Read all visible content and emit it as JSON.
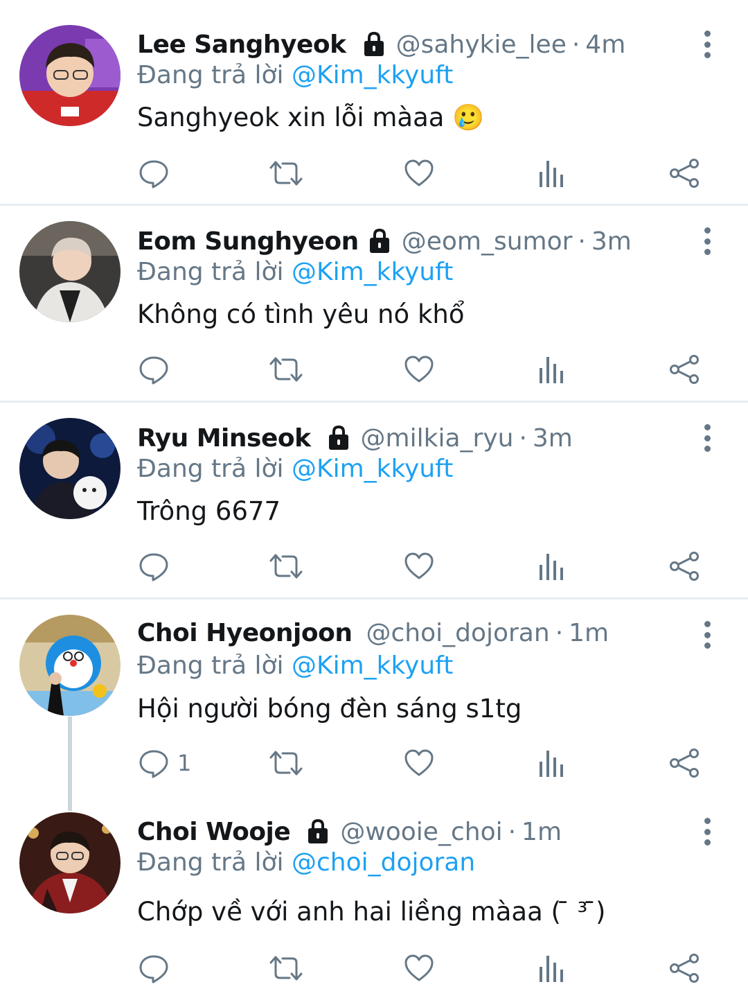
{
  "tweets": [
    {
      "name": "Lee Sanghyeok",
      "handle": "@sahykie_lee",
      "separator": "·",
      "time": "4m",
      "protected": true,
      "replying_prefix": "Đang trả lời ",
      "replying_to": "@Kim_kkyuft",
      "text": "Sanghyeok xin lỗi màaa 🥲",
      "reply_count": ""
    },
    {
      "name": "Eom Sunghyeon",
      "handle": "@eom_sumor",
      "separator": "·",
      "time": "3m",
      "protected": true,
      "replying_prefix": "Đang trả lời ",
      "replying_to": "@Kim_kkyuft",
      "text": "Không có tình yêu nó khổ",
      "reply_count": ""
    },
    {
      "name": "Ryu Minseok",
      "handle": "@milkia_ryu",
      "separator": "·",
      "time": "3m",
      "protected": true,
      "replying_prefix": "Đang trả lời ",
      "replying_to": "@Kim_kkyuft",
      "text": "Trông 6677",
      "reply_count": ""
    },
    {
      "name": "Choi Hyeonjoon",
      "handle": "@choi_dojoran",
      "separator": "·",
      "time": "1m",
      "protected": false,
      "replying_prefix": "Đang trả lời ",
      "replying_to": "@Kim_kkyuft",
      "text": "Hội người bóng đèn sáng s1tg",
      "reply_count": "1"
    },
    {
      "name": "Choi Wooje",
      "handle": "@wooie_choi",
      "separator": "·",
      "time": "1m",
      "protected": true,
      "replying_prefix": "Đang trả lời ",
      "replying_to": "@choi_dojoran",
      "text": "Chớp về với anh hai liềng màaa ( ̄ ³ ̄)",
      "reply_count": ""
    }
  ],
  "icons": {
    "reply": "reply-icon",
    "retweet": "retweet-icon",
    "like": "heart-icon",
    "views": "views-icon",
    "share": "share-icon",
    "more": "more-options-icon",
    "lock": "lock-icon"
  },
  "colors": {
    "text": "#14171a",
    "secondary": "#657786",
    "mention": "#1da1f2",
    "divider": "#e6ecf0",
    "thread": "#ccd6dd"
  }
}
